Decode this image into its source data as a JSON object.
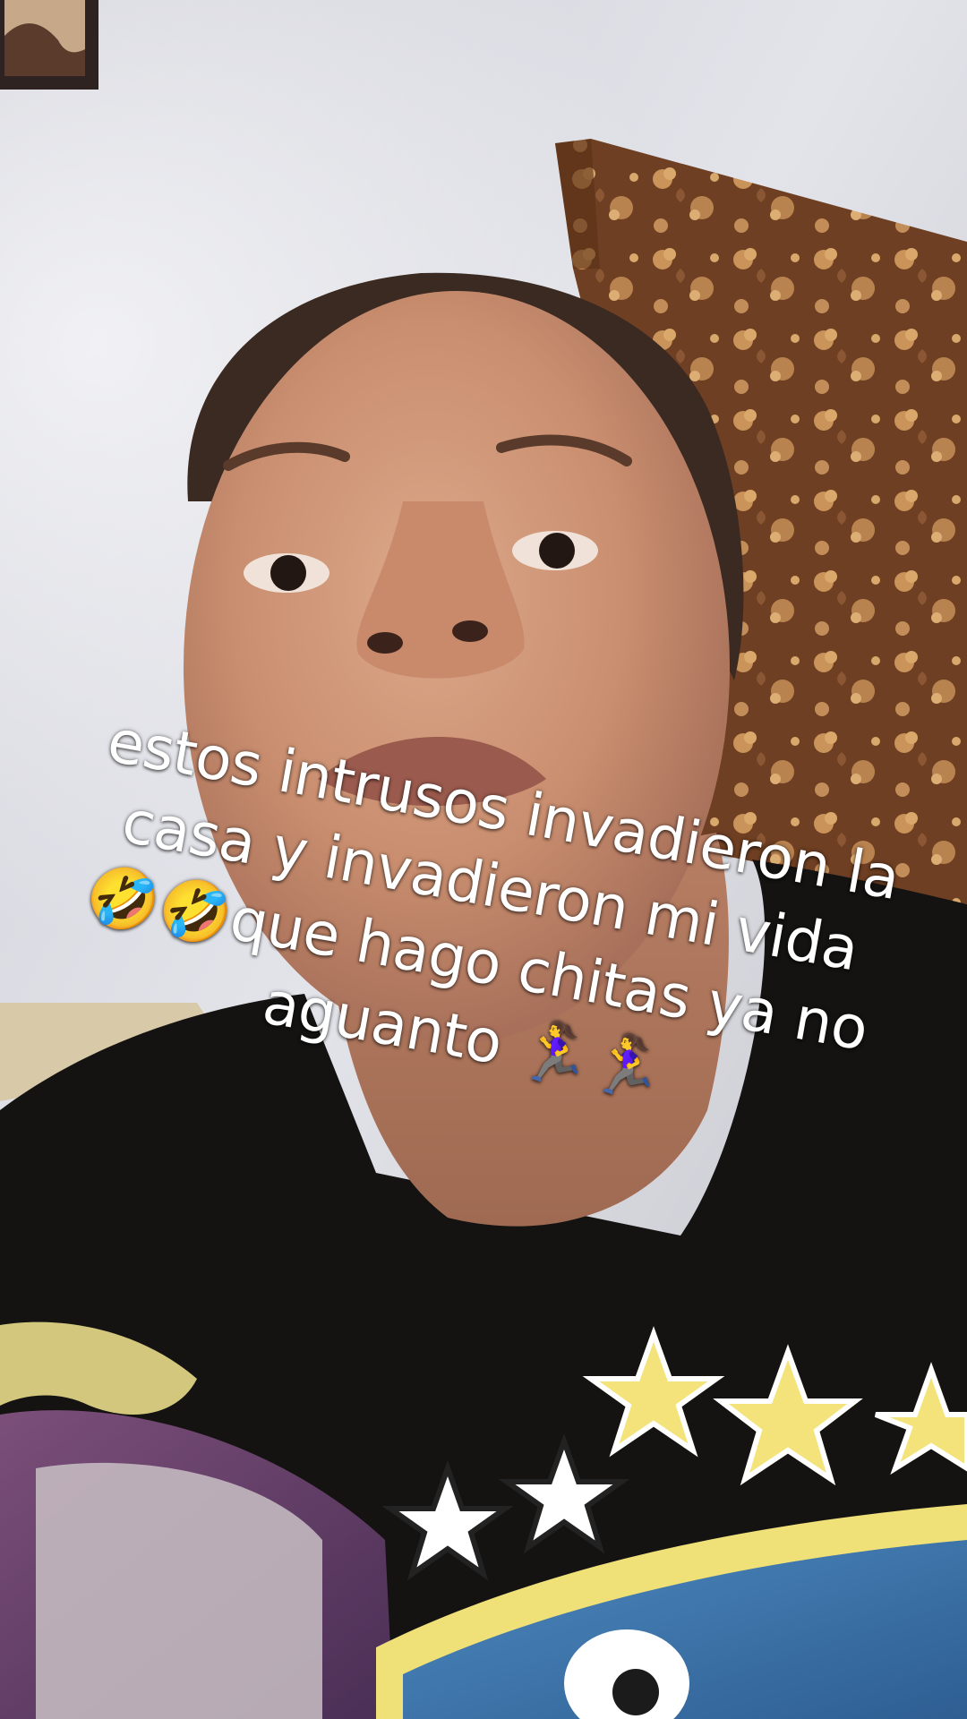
{
  "caption": {
    "lines": [
      "estos intrusos invadieron la",
      "casa y invadieron mi vida",
      "🤣🤣que hago chitas ya no",
      "aguanto 🏃‍♀️🏃‍♀️"
    ]
  },
  "photo": {
    "wall_color": "#dcdde4",
    "curtain_color": "#7a4a2c",
    "shirt_color": "#141312",
    "star_colors": [
      "#f3e37a",
      "#ffffff"
    ]
  }
}
